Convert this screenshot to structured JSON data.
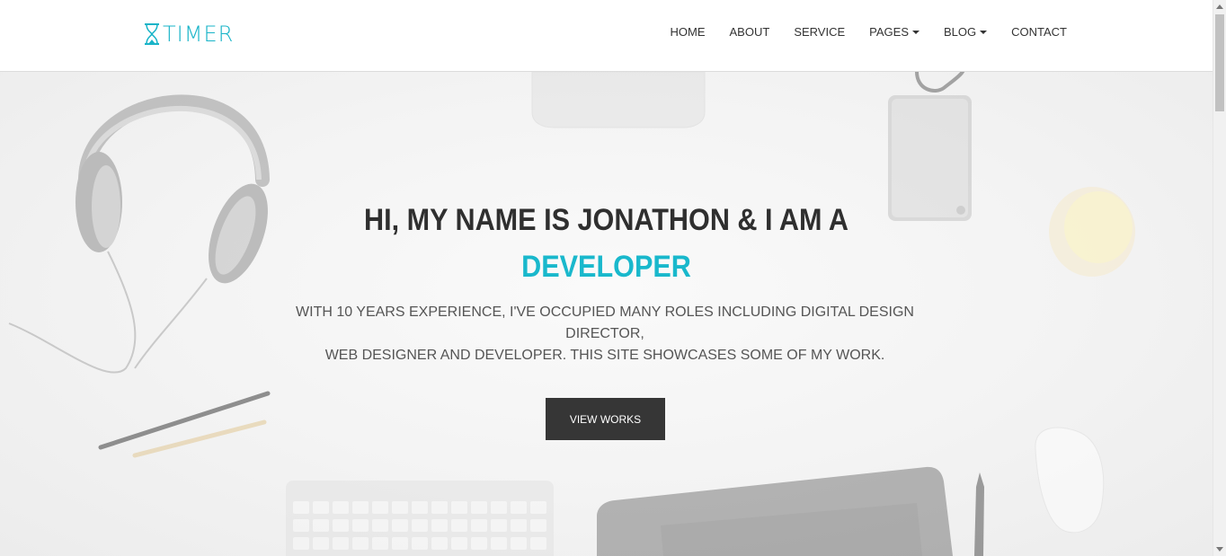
{
  "brand": {
    "logo_text": "TIMER",
    "logo_icon": "hourglass-icon",
    "accent_color": "#19b8cc"
  },
  "nav": {
    "items": [
      {
        "label": "HOME",
        "dropdown": false
      },
      {
        "label": "ABOUT",
        "dropdown": false
      },
      {
        "label": "SERVICE",
        "dropdown": false
      },
      {
        "label": "PAGES",
        "dropdown": true
      },
      {
        "label": "BLOG",
        "dropdown": true
      },
      {
        "label": "CONTACT",
        "dropdown": false
      }
    ]
  },
  "hero": {
    "title": "HI, MY NAME IS JONATHON & I AM A",
    "role": "DEVELOPER",
    "description_line1": "WITH 10 YEARS EXPERIENCE, I'VE OCCUPIED MANY ROLES INCLUDING DIGITAL DESIGN DIRECTOR,",
    "description_line2": "WEB DESIGNER AND DEVELOPER. THIS SITE SHOWCASES SOME OF MY WORK.",
    "cta_label": "VIEW WORKS",
    "cta_color": "#363636"
  }
}
